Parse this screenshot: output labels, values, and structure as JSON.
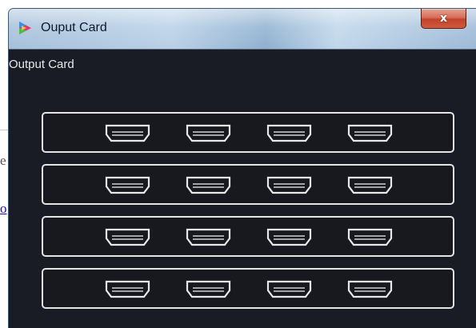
{
  "window": {
    "title": "Ouput Card",
    "close_glyph": "x",
    "app_icon": "tricolor-app-icon"
  },
  "client": {
    "heading": "Output Card"
  },
  "background": {
    "text_fragment": "e",
    "link_fragment": "o"
  },
  "slots": [
    {
      "ports": [
        "hdmi-port-icon",
        "hdmi-port-icon",
        "hdmi-port-icon",
        "hdmi-port-icon"
      ]
    },
    {
      "ports": [
        "hdmi-port-icon",
        "hdmi-port-icon",
        "hdmi-port-icon",
        "hdmi-port-icon"
      ]
    },
    {
      "ports": [
        "hdmi-port-icon",
        "hdmi-port-icon",
        "hdmi-port-icon",
        "hdmi-port-icon"
      ]
    },
    {
      "ports": [
        "hdmi-port-icon",
        "hdmi-port-icon",
        "hdmi-port-icon",
        "hdmi-port-icon"
      ]
    }
  ],
  "colors": {
    "client_background": "#1a1c25",
    "slot_border": "#e4e4e4",
    "close_button": "#c4412a"
  }
}
